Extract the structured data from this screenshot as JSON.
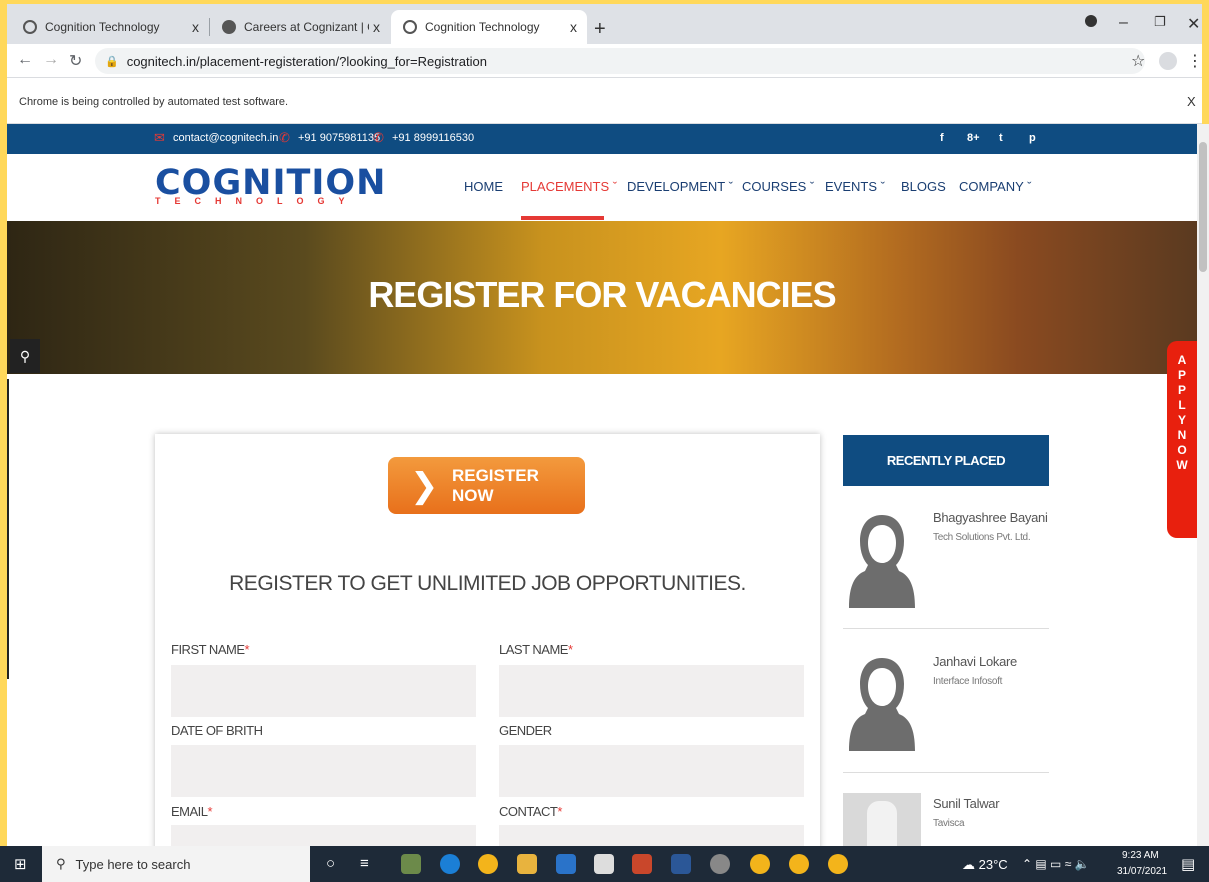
{
  "browser": {
    "tabs": [
      {
        "title": "Cognition Technology",
        "active": false
      },
      {
        "title": "Careers at Cognizant | Cognizant",
        "active": false
      },
      {
        "title": "Cognition Technology",
        "active": true
      }
    ],
    "new_tab": "+",
    "close_glyph": "x",
    "url": "cognitech.in/placement-registeration/?looking_for=Registration",
    "infobar": "Chrome is being controlled by automated test software.",
    "infobar_close": "X"
  },
  "site": {
    "topbar": {
      "email": "contact@cognitech.in",
      "phone1": "+91 9075981135",
      "phone2": "+91 8999116530",
      "social": [
        "f",
        "8+",
        "t",
        "p"
      ]
    },
    "logo": {
      "main": "COGNITION",
      "sub": "TECHNOLOGY"
    },
    "menu": [
      {
        "label": "HOME",
        "active": false
      },
      {
        "label": "PLACEMENTS",
        "active": true
      },
      {
        "label": "DEVELOPMENT",
        "active": false
      },
      {
        "label": "COURSES",
        "active": false
      },
      {
        "label": "EVENTS",
        "active": false
      },
      {
        "label": "BLOGS",
        "active": false
      },
      {
        "label": "COMPANY",
        "active": false
      }
    ],
    "hero_title": "REGISTER FOR VACANCIES",
    "register_button": "REGISTER NOW",
    "form_title": "REGISTER TO GET UNLIMITED JOB OPPORTUNITIES.",
    "fields": [
      {
        "label": "FIRST NAME",
        "required": true
      },
      {
        "label": "LAST NAME",
        "required": true
      },
      {
        "label": "DATE OF BRITH",
        "required": false
      },
      {
        "label": "GENDER",
        "required": false
      },
      {
        "label": "EMAIL",
        "required": true
      },
      {
        "label": "CONTACT",
        "required": true
      }
    ],
    "required_mark": "*",
    "recently_placed": {
      "title": "RECENTLY PLACED",
      "people": [
        {
          "name": "Bhagyashree Bayani",
          "company": "Tech Solutions Pvt. Ltd."
        },
        {
          "name": "Janhavi Lokare",
          "company": "Interface Infosoft"
        },
        {
          "name": "Sunil Talwar",
          "company": "Tavisca"
        }
      ]
    },
    "apply_now": "APPLY NOW",
    "colors": {
      "navy": "#0f4c81",
      "accent_red": "#e53935",
      "orange": "#e8701b"
    }
  },
  "taskbar": {
    "search_placeholder": "Type here to search",
    "weather": "23°C",
    "time": "9:23 AM",
    "date": "31/07/2021"
  }
}
